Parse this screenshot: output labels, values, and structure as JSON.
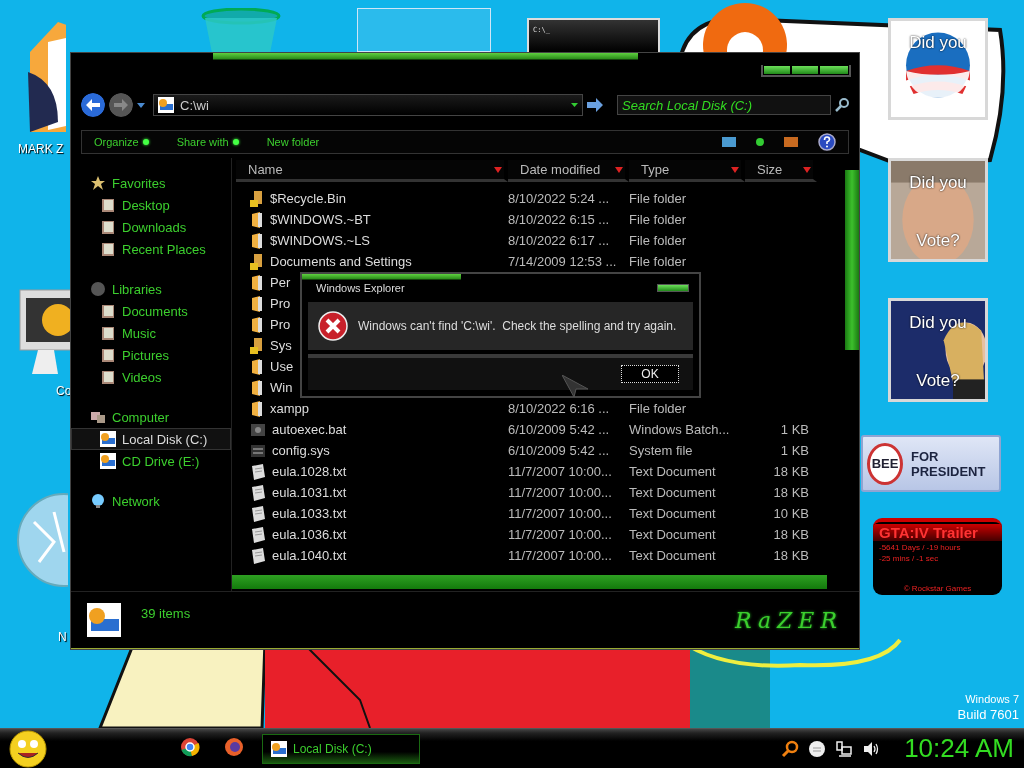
{
  "desktop": {
    "icons": [
      {
        "kind": "folder",
        "label": "MARK Z"
      },
      {
        "kind": "recycle-bin"
      },
      {
        "kind": "selection"
      },
      {
        "kind": "console",
        "screen_text": "C:\\_"
      },
      {
        "kind": "computer",
        "label": "Co"
      },
      {
        "kind": "globe"
      },
      {
        "kind": "blank",
        "label": "N"
      }
    ],
    "wallpaper": {
      "kind": "picture"
    },
    "os_info": [
      "Windows 7",
      "Build 7601"
    ]
  },
  "gadgets": [
    {
      "kind": "poster",
      "lines": [
        "Did you"
      ]
    },
    {
      "kind": "poster",
      "lines": [
        "Did you",
        "Vote?"
      ]
    },
    {
      "kind": "poster",
      "lines": [
        "Did you",
        "Vote?"
      ]
    },
    {
      "kind": "banner",
      "badge": "BEE",
      "text": "FOR PRESIDENT"
    },
    {
      "kind": "countdown",
      "title": "GTA:IV  Trailer",
      "lines": [
        "-5641 Days / -19 hours",
        "-25 mins / -1 sec"
      ],
      "footer": "© Rockstar Games"
    }
  ],
  "explorer": {
    "address": "C:\\wi",
    "search": {
      "placeholder": "Search Local Disk (C:)"
    },
    "toolbar": [
      {
        "label": "Organize",
        "kind": "menu"
      },
      {
        "label": "Share with",
        "kind": "menu"
      },
      {
        "label": "New folder",
        "kind": "button"
      }
    ],
    "sidebar": [
      {
        "label": "Favorites",
        "selected": false,
        "children": [
          {
            "label": "Desktop",
            "selected": false
          },
          {
            "label": "Downloads",
            "selected": false
          },
          {
            "label": "Recent Places",
            "selected": false
          }
        ]
      },
      {
        "label": "Libraries",
        "selected": false,
        "children": [
          {
            "label": "Documents",
            "selected": false
          },
          {
            "label": "Music",
            "selected": false
          },
          {
            "label": "Pictures",
            "selected": false
          },
          {
            "label": "Videos",
            "selected": false
          }
        ]
      },
      {
        "label": "Computer",
        "selected": false,
        "children": [
          {
            "label": "Local Disk (C:)",
            "selected": true
          },
          {
            "label": "CD Drive (E:)",
            "selected": false
          }
        ]
      },
      {
        "label": "Network",
        "selected": false
      }
    ],
    "columns": [
      "Name",
      "Date modified",
      "Type",
      "Size"
    ],
    "rows": [
      {
        "kind": "locked-folder",
        "name": "$Recycle.Bin",
        "date": "8/10/2022 5:24 ...",
        "type": "File folder"
      },
      {
        "kind": "folder",
        "name": "$WINDOWS.~BT",
        "date": "8/10/2022 6:15 ...",
        "type": "File folder"
      },
      {
        "kind": "folder",
        "name": "$WINDOWS.~LS",
        "date": "8/10/2022 6:17 ...",
        "type": "File folder"
      },
      {
        "kind": "locked-folder",
        "name": "Documents and Settings",
        "date": "7/14/2009 12:53 ...",
        "type": "File folder"
      },
      {
        "kind": "folder",
        "name": "Per"
      },
      {
        "kind": "folder",
        "name": "Pro"
      },
      {
        "kind": "folder",
        "name": "Pro"
      },
      {
        "kind": "locked-folder",
        "name": "Sys"
      },
      {
        "kind": "folder",
        "name": "Use"
      },
      {
        "kind": "folder",
        "name": "Win"
      },
      {
        "kind": "folder",
        "name": "xampp",
        "date": "8/10/2022 6:16 ...",
        "type": "File folder"
      },
      {
        "kind": "batch",
        "name": "autoexec.bat",
        "date": "6/10/2009 5:42 ...",
        "type": "Windows Batch...",
        "size": "1 KB"
      },
      {
        "kind": "system",
        "name": "config.sys",
        "date": "6/10/2009 5:42 ...",
        "type": "System file",
        "size": "1 KB"
      },
      {
        "kind": "text",
        "name": "eula.1028.txt",
        "date": "11/7/2007 10:00...",
        "type": "Text Document",
        "size": "18 KB"
      },
      {
        "kind": "text",
        "name": "eula.1031.txt",
        "date": "11/7/2007 10:00...",
        "type": "Text Document",
        "size": "18 KB"
      },
      {
        "kind": "text",
        "name": "eula.1033.txt",
        "date": "11/7/2007 10:00...",
        "type": "Text Document",
        "size": "10 KB"
      },
      {
        "kind": "text",
        "name": "eula.1036.txt",
        "date": "11/7/2007 10:00...",
        "type": "Text Document",
        "size": "18 KB"
      },
      {
        "kind": "text",
        "name": "eula.1040.txt",
        "date": "11/7/2007 10:00...",
        "type": "Text Document",
        "size": "18 KB"
      }
    ],
    "status": "39 items",
    "logo": "RaZER"
  },
  "dialog": {
    "title": "Windows Explorer",
    "message": "Windows can't find 'C:\\wi'.  Check the spelling and try again.",
    "buttons": [
      "OK"
    ]
  },
  "taskbar": {
    "tasks": [
      {
        "label": "Local Disk (C:)",
        "selected": true
      }
    ],
    "clock": "10:24 AM"
  }
}
